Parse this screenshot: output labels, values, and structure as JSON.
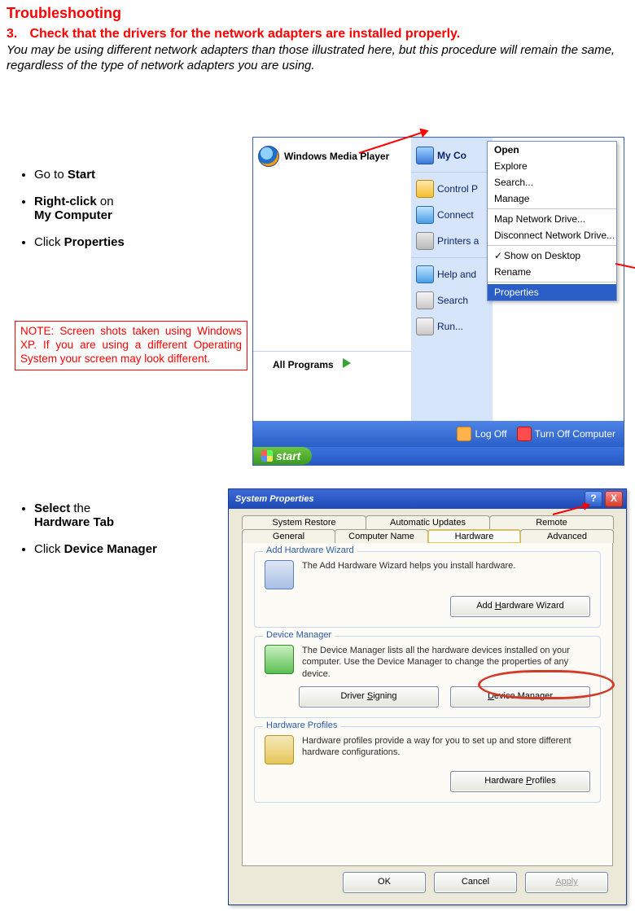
{
  "doc": {
    "title": "Troubleshooting",
    "section_number": "3.",
    "section_title": "Check that the drivers for the network adapters are installed properly.",
    "intro": "You may be using different network adapters than those illustrated here, but this procedure will remain the same, regardless of the type of network adapters you are using.",
    "note_label": "NOTE",
    "note_text": ": Screen shots taken using Windows XP. If you are using a different Operating System your screen may look different.",
    "bullets1": {
      "b1_pre": "Go to ",
      "b1_bold": "Start",
      "b2_bold": "Right-click",
      "b2_post": " on ",
      "b2_bold2": "My Computer",
      "b3_pre": "Click ",
      "b3_bold": "Properties"
    },
    "bullets2": {
      "b1_bold": "Select",
      "b1_post": " the",
      "b1_bold2": "Hardware Tab",
      "b2_pre": "Click ",
      "b2_bold": "Device Manager"
    }
  },
  "shot1": {
    "wmp": "Windows Media Player",
    "all_programs": "All Programs",
    "right_items": {
      "mycomp": "My Co",
      "cpl": "Control P",
      "conn": "Connect",
      "prn": "Printers a",
      "help": "Help and",
      "search": "Search",
      "run": "Run..."
    },
    "bottom": {
      "logoff": "Log Off",
      "turnoff": "Turn Off Computer",
      "start": "start"
    },
    "ctx": {
      "open": "Open",
      "explore": "Explore",
      "search": "Search...",
      "manage": "Manage",
      "mapdrv": "Map Network Drive...",
      "discdrv": "Disconnect Network Drive...",
      "showdesk": "Show on Desktop",
      "rename": "Rename",
      "props": "Properties"
    }
  },
  "shot2": {
    "title": "System Properties",
    "help_btn": "?",
    "close_btn": "X",
    "tabs_row1": {
      "sysrestore": "System Restore",
      "autoupdate": "Automatic Updates",
      "remote": "Remote"
    },
    "tabs_row2": {
      "general": "General",
      "compname": "Computer Name",
      "hardware": "Hardware",
      "advanced": "Advanced"
    },
    "group_hw": {
      "legend": "Add Hardware Wizard",
      "desc": "The Add Hardware Wizard helps you install hardware.",
      "btn_pre": "Add ",
      "btn_u": "H",
      "btn_post": "ardware Wizard"
    },
    "group_dm": {
      "legend": "Device Manager",
      "desc": "The Device Manager lists all the hardware devices installed on your computer. Use the Device Manager to change the properties of any device.",
      "btn1_pre": "Driver ",
      "btn1_u": "S",
      "btn1_post": "igning",
      "btn2_u": "D",
      "btn2_post": "evice Manager"
    },
    "group_hp": {
      "legend": "Hardware Profiles",
      "desc": "Hardware profiles provide a way for you to set up and store different hardware configurations.",
      "btn_pre": "Hardware ",
      "btn_u": "P",
      "btn_post": "rofiles"
    },
    "footer": {
      "ok": "OK",
      "cancel": "Cancel",
      "apply": "Apply"
    }
  }
}
